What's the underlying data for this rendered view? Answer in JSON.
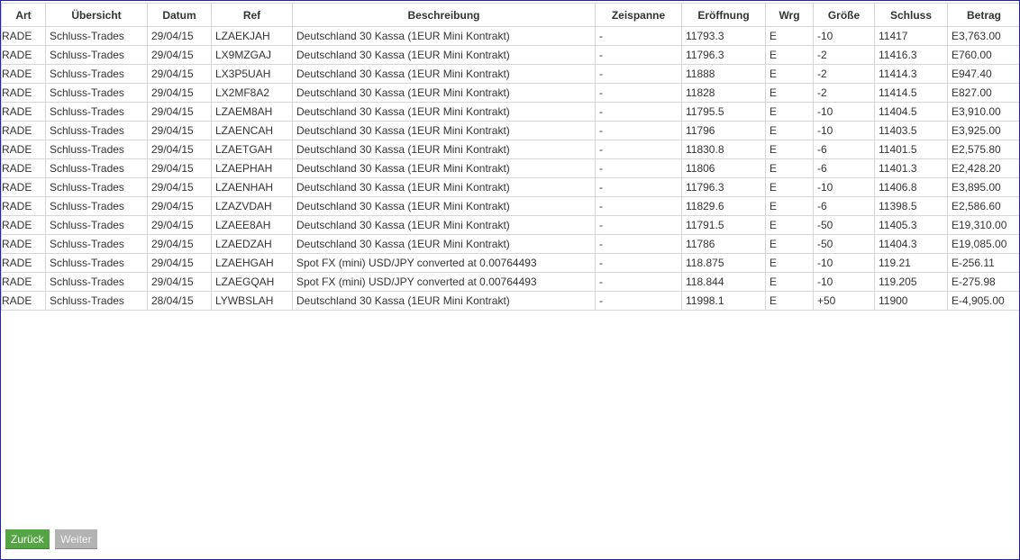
{
  "table": {
    "headers": [
      "Art",
      "Übersicht",
      "Datum",
      "Ref",
      "Beschreibung",
      "Zeispanne",
      "Eröffnung",
      "Wrg",
      "Größe",
      "Schluss",
      "Betrag"
    ],
    "rows": [
      [
        "RADE",
        "Schluss-Trades",
        "29/04/15",
        "LZAEKJAH",
        "Deutschland 30 Kassa (1EUR Mini Kontrakt)",
        "-",
        "11793.3",
        "E",
        "-10",
        "11417",
        "E3,763.00"
      ],
      [
        "RADE",
        "Schluss-Trades",
        "29/04/15",
        "LX9MZGAJ",
        "Deutschland 30 Kassa (1EUR Mini Kontrakt)",
        "-",
        "11796.3",
        "E",
        "-2",
        "11416.3",
        "E760.00"
      ],
      [
        "RADE",
        "Schluss-Trades",
        "29/04/15",
        "LX3P5UAH",
        "Deutschland 30 Kassa (1EUR Mini Kontrakt)",
        "-",
        "11888",
        "E",
        "-2",
        "11414.3",
        "E947.40"
      ],
      [
        "RADE",
        "Schluss-Trades",
        "29/04/15",
        "LX2MF8A2",
        "Deutschland 30 Kassa (1EUR Mini Kontrakt)",
        "-",
        "11828",
        "E",
        "-2",
        "11414.5",
        "E827.00"
      ],
      [
        "RADE",
        "Schluss-Trades",
        "29/04/15",
        "LZAEM8AH",
        "Deutschland 30 Kassa (1EUR Mini Kontrakt)",
        "-",
        "11795.5",
        "E",
        "-10",
        "11404.5",
        "E3,910.00"
      ],
      [
        "RADE",
        "Schluss-Trades",
        "29/04/15",
        "LZAENCAH",
        "Deutschland 30 Kassa (1EUR Mini Kontrakt)",
        "-",
        "11796",
        "E",
        "-10",
        "11403.5",
        "E3,925.00"
      ],
      [
        "RADE",
        "Schluss-Trades",
        "29/04/15",
        "LZAETGAH",
        "Deutschland 30 Kassa (1EUR Mini Kontrakt)",
        "-",
        "11830.8",
        "E",
        "-6",
        "11401.5",
        "E2,575.80"
      ],
      [
        "RADE",
        "Schluss-Trades",
        "29/04/15",
        "LZAEPHAH",
        "Deutschland 30 Kassa (1EUR Mini Kontrakt)",
        "-",
        "11806",
        "E",
        "-6",
        "11401.3",
        "E2,428.20"
      ],
      [
        "RADE",
        "Schluss-Trades",
        "29/04/15",
        "LZAENHAH",
        "Deutschland 30 Kassa (1EUR Mini Kontrakt)",
        "-",
        "11796.3",
        "E",
        "-10",
        "11406.8",
        "E3,895.00"
      ],
      [
        "RADE",
        "Schluss-Trades",
        "29/04/15",
        "LZAZVDAH",
        "Deutschland 30 Kassa (1EUR Mini Kontrakt)",
        "-",
        "11829.6",
        "E",
        "-6",
        "11398.5",
        "E2,586.60"
      ],
      [
        "RADE",
        "Schluss-Trades",
        "29/04/15",
        "LZAEE8AH",
        "Deutschland 30 Kassa (1EUR Mini Kontrakt)",
        "-",
        "11791.5",
        "E",
        "-50",
        "11405.3",
        "E19,310.00"
      ],
      [
        "RADE",
        "Schluss-Trades",
        "29/04/15",
        "LZAEDZAH",
        "Deutschland 30 Kassa (1EUR Mini Kontrakt)",
        "-",
        "11786",
        "E",
        "-50",
        "11404.3",
        "E19,085.00"
      ],
      [
        "RADE",
        "Schluss-Trades",
        "29/04/15",
        "LZAEHGAH",
        "Spot FX (mini) USD/JPY converted at 0.00764493",
        "-",
        "118.875",
        "E",
        "-10",
        "119.21",
        "E-256.11"
      ],
      [
        "RADE",
        "Schluss-Trades",
        "29/04/15",
        "LZAEGQAH",
        "Spot FX (mini) USD/JPY converted at 0.00764493",
        "-",
        "118.844",
        "E",
        "-10",
        "119.205",
        "E-275.98"
      ],
      [
        "RADE",
        "Schluss-Trades",
        "28/04/15",
        "LYWBSLAH",
        "Deutschland 30 Kassa (1EUR Mini Kontrakt)",
        "-",
        "11998.1",
        "E",
        "+50",
        "11900",
        "E-4,905.00"
      ]
    ]
  },
  "nav": {
    "back_label": "Zurück",
    "next_label": "Weiter"
  }
}
